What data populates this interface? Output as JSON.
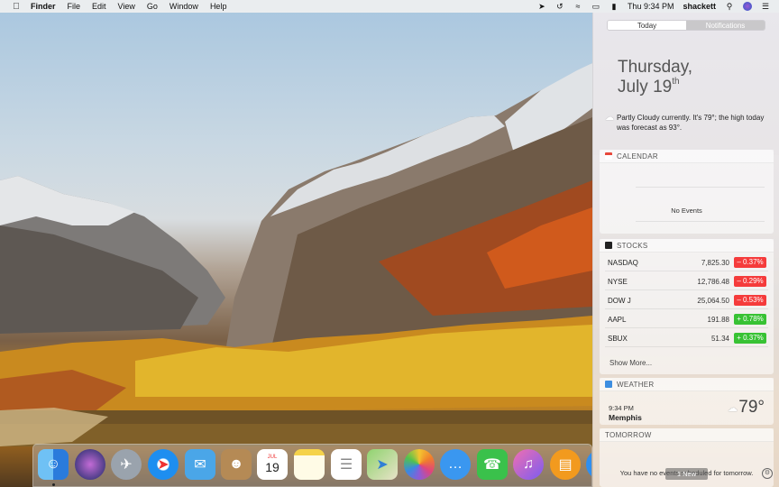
{
  "menubar": {
    "apple_icon": "apple-icon",
    "items": [
      "Finder",
      "File",
      "Edit",
      "View",
      "Go",
      "Window",
      "Help"
    ],
    "clock": "Thu 9:34 PM",
    "user": "shackett",
    "status_icons": [
      "location-icon",
      "time-machine-icon",
      "wifi-icon",
      "airplay-icon",
      "battery-icon",
      "search-icon",
      "siri-icon",
      "notification-center-icon"
    ]
  },
  "notification_center": {
    "tabs": [
      "Today",
      "Notifications"
    ],
    "active_tab": "Today",
    "date_line1": "Thursday,",
    "date_line2": "July 19",
    "date_suffix": "th",
    "summary": "Partly Cloudy currently. It's 79°; the high today was forecast as 93°.",
    "calendar": {
      "title": "CALENDAR",
      "empty": "No Events",
      "accent": "#e8483b"
    },
    "stocks": {
      "title": "STOCKS",
      "rows": [
        {
          "symbol": "NASDAQ",
          "price": "7,825.30",
          "change": "– 0.37%",
          "dir": "neg"
        },
        {
          "symbol": "NYSE",
          "price": "12,786.48",
          "change": "– 0.29%",
          "dir": "neg"
        },
        {
          "symbol": "DOW J",
          "price": "25,064.50",
          "change": "– 0.53%",
          "dir": "neg"
        },
        {
          "symbol": "AAPL",
          "price": "191.88",
          "change": "+ 0.78%",
          "dir": "pos"
        },
        {
          "symbol": "SBUX",
          "price": "51.34",
          "change": "+ 0.37%",
          "dir": "pos"
        }
      ],
      "more": "Show More...",
      "neg_color": "#f53b3b",
      "pos_color": "#38c234"
    },
    "weather": {
      "title": "WEATHER",
      "time": "9:34 PM",
      "city": "Memphis",
      "temp": "79°"
    },
    "tomorrow": {
      "title": "TOMORROW",
      "message": "You have no events scheduled for tomorrow."
    },
    "new_button": "1 New"
  },
  "dock": {
    "apps": [
      "finder",
      "siri",
      "launchpad",
      "safari",
      "mail",
      "contacts",
      "calendar",
      "notes",
      "reminders",
      "maps",
      "photos",
      "messages",
      "facetime",
      "itunes",
      "ibooks",
      "app-store"
    ],
    "calendar_month": "JUL",
    "calendar_day": "19"
  }
}
